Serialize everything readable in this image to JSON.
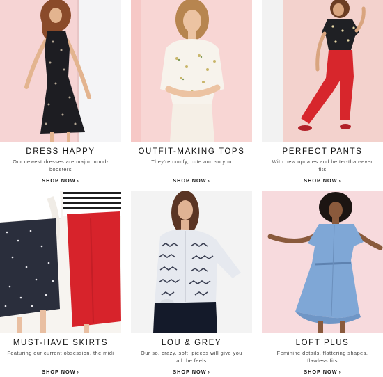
{
  "tiles": [
    {
      "title": "DRESS HAPPY",
      "desc": "Our newest dresses are major mood-boosters",
      "cta": "SHOP NOW",
      "cta_arrow": "›",
      "bg": "#f6d6d6"
    },
    {
      "title": "OUTFIT-MAKING TOPS",
      "desc": "They're comfy, cute and so you",
      "cta": "SHOP NOW",
      "cta_arrow": "›",
      "bg": "#f8d7d5"
    },
    {
      "title": "PERFECT PANTS",
      "desc": "With new updates and better-than-ever fits",
      "cta": "SHOP NOW",
      "cta_arrow": "›",
      "bg": "#f3d3cf"
    },
    {
      "title": "MUST-HAVE SKIRTS",
      "desc": "Featuring our current obsession, the midi",
      "cta": "SHOP NOW",
      "cta_arrow": "›",
      "bg": "#f4f2f0"
    },
    {
      "title": "LOU & GREY",
      "desc": "Our so. crazy. soft. pieces will give you all the feels",
      "cta": "SHOP NOW",
      "cta_arrow": "›",
      "bg": "#f3f3f3"
    },
    {
      "title": "LOFT PLUS",
      "desc": "Feminine details, flattering shapes, flawless fits",
      "cta": "SHOP NOW",
      "cta_arrow": "›",
      "bg": "#f7dde0"
    }
  ]
}
